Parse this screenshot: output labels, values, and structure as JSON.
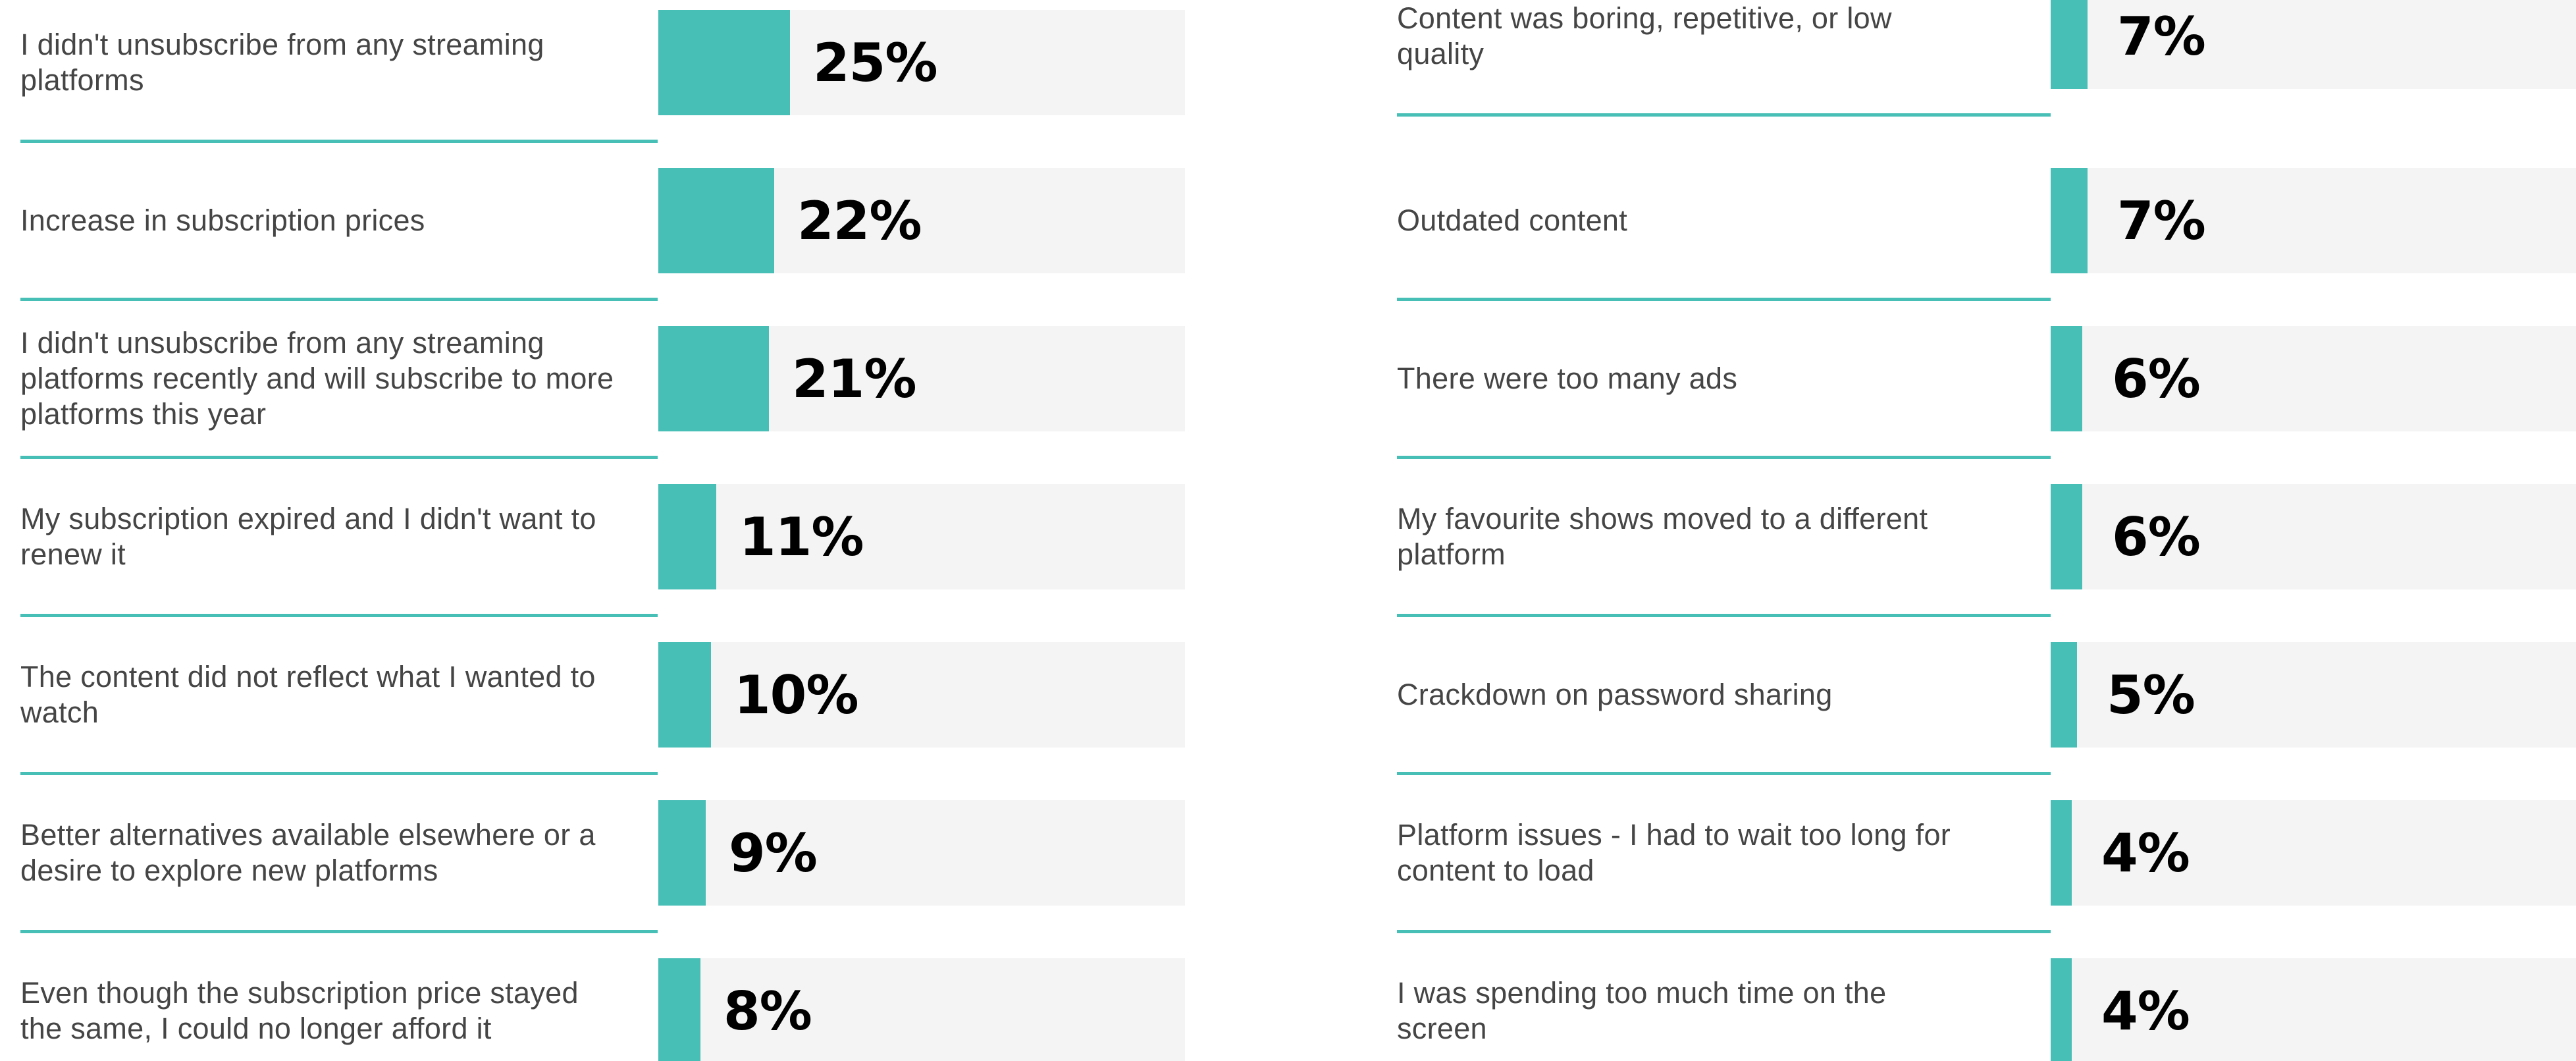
{
  "colors": {
    "bar": "#47BEB6",
    "track": "#F4F4F4",
    "divider": "#47BEB6",
    "label_text": "#454545",
    "value_text": "#000000"
  },
  "chart_data": [
    {
      "type": "bar",
      "orientation": "horizontal",
      "title": "",
      "xlabel": "",
      "ylabel": "",
      "xlim": [
        0,
        100
      ],
      "value_unit": "%",
      "categories": [
        "I didn't unsubscribe from any streaming platforms",
        "Increase in subscription prices",
        "I didn't unsubscribe from any streaming platforms recently and will subscribe to more platforms this year",
        "My subscription expired and I didn't want to renew it",
        "The content did not reflect what I wanted to watch",
        "Better alternatives available elsewhere or a desire to explore new platforms",
        "Even though the subscription price stayed the same, I could no longer afford it"
      ],
      "values": [
        25,
        22,
        21,
        11,
        10,
        9,
        8
      ],
      "value_labels": [
        "25%",
        "22%",
        "21%",
        "11%",
        "10%",
        "9%",
        "8%"
      ]
    },
    {
      "type": "bar",
      "orientation": "horizontal",
      "title": "",
      "xlabel": "",
      "ylabel": "",
      "xlim": [
        0,
        100
      ],
      "value_unit": "%",
      "categories": [
        "Content was boring, repetitive, or low quality",
        "Outdated content",
        "There were too many ads",
        "My favourite shows moved to a different platform",
        "Crackdown on password sharing",
        "Platform issues - I had to wait too long for content to load",
        "I was spending too much time on the screen"
      ],
      "values": [
        7,
        7,
        6,
        6,
        5,
        4,
        4
      ],
      "value_labels": [
        "7%",
        "7%",
        "6%",
        "6%",
        "5%",
        "4%",
        "4%"
      ]
    }
  ]
}
